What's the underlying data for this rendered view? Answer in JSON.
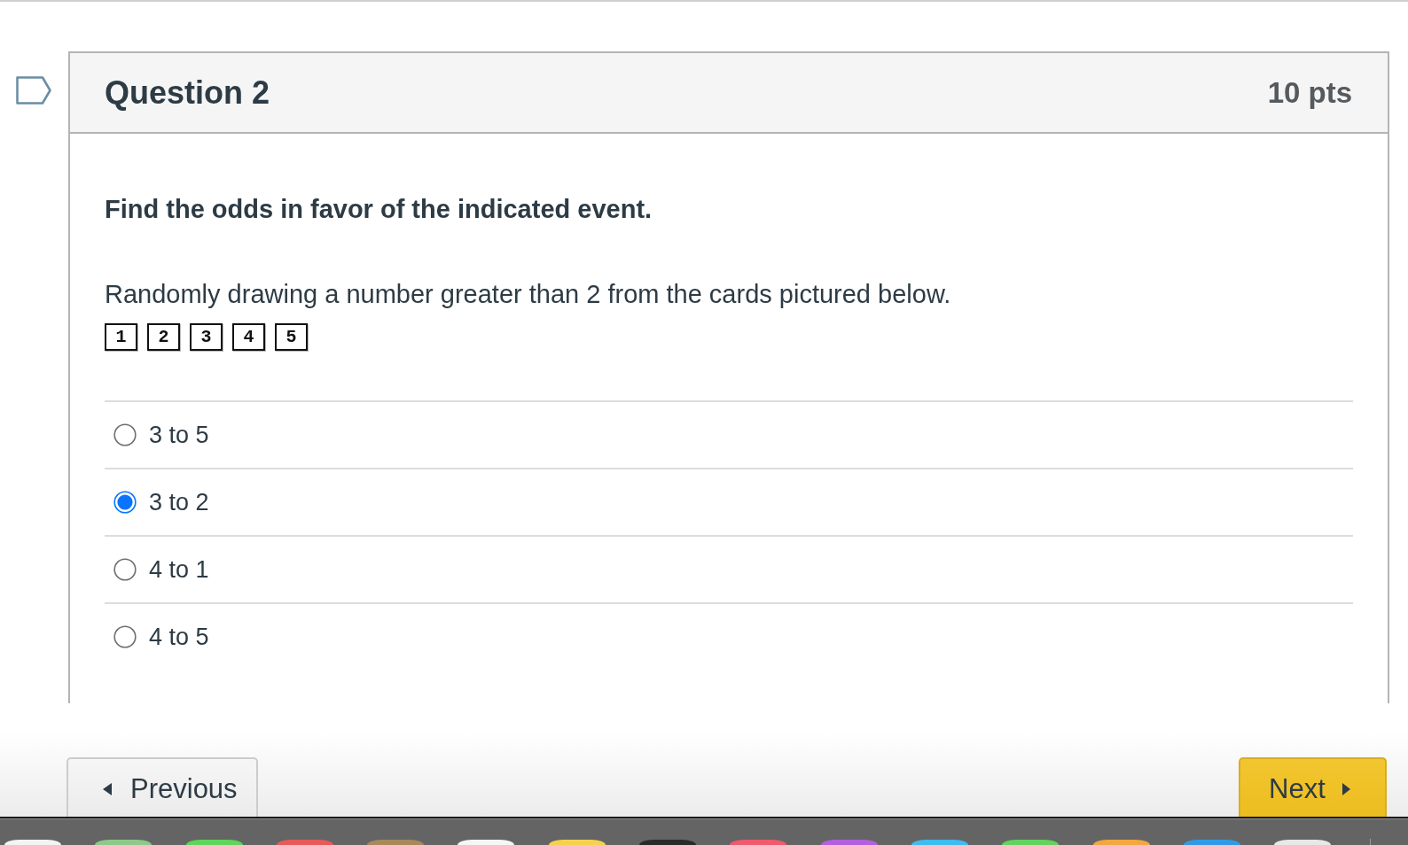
{
  "question": {
    "flagged": false,
    "title": "Question 2",
    "points": "10 pts",
    "prompt": "Find the odds in favor of the indicated event.",
    "text": "Randomly drawing a number greater than 2 from the cards pictured below.",
    "cards": [
      "1",
      "2",
      "3",
      "4",
      "5"
    ],
    "answers": [
      {
        "label": "3 to 5",
        "selected": false
      },
      {
        "label": "3 to 2",
        "selected": true
      },
      {
        "label": "4 to 1",
        "selected": false
      },
      {
        "label": "4 to 5",
        "selected": false
      }
    ]
  },
  "navigation": {
    "previous": "Previous",
    "next": "Next"
  },
  "dock": {
    "apps": [
      {
        "color": "#f4f4f4"
      },
      {
        "color": "#8cc98a"
      },
      {
        "color": "#5dd65c"
      },
      {
        "color": "#e85a5a"
      },
      {
        "color": "#a8895c"
      },
      {
        "color": "#f6f6f6"
      },
      {
        "color": "#f4d250"
      },
      {
        "color": "#2a2a2a"
      },
      {
        "color": "#ef5a6e"
      },
      {
        "color": "#b360e0"
      },
      {
        "color": "#3cbcef"
      },
      {
        "color": "#62d35e"
      },
      {
        "color": "#f4a640"
      },
      {
        "color": "#2f9be8"
      },
      {
        "color": "#e8e8e8"
      }
    ]
  }
}
